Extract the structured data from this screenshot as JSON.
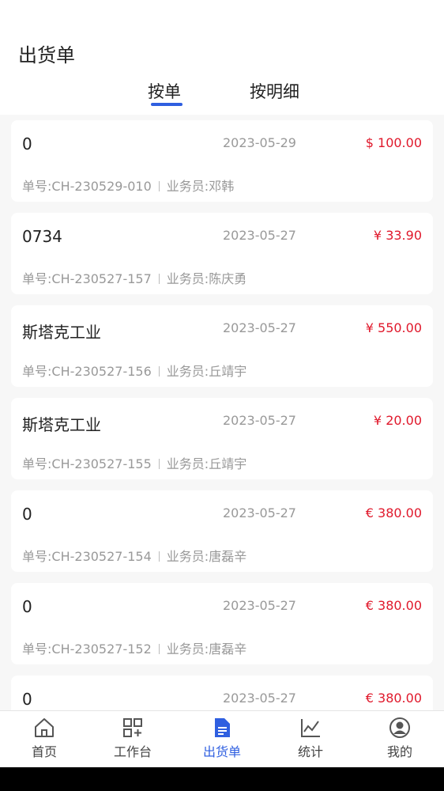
{
  "header": {
    "title": "出货单"
  },
  "tabs": [
    {
      "label": "按单",
      "active": true
    },
    {
      "label": "按明细",
      "active": false
    }
  ],
  "labels": {
    "order_no": "单号:",
    "salesperson": "业务员:"
  },
  "orders": [
    {
      "customer": "0",
      "date": "2023-05-29",
      "amount": "$ 100.00",
      "order_no": "CH-230529-010",
      "salesperson": "邓韩"
    },
    {
      "customer": "0734",
      "date": "2023-05-27",
      "amount": "¥ 33.90",
      "order_no": "CH-230527-157",
      "salesperson": "陈庆勇"
    },
    {
      "customer": "斯塔克工业",
      "date": "2023-05-27",
      "amount": "¥ 550.00",
      "order_no": "CH-230527-156",
      "salesperson": "丘靖宇"
    },
    {
      "customer": "斯塔克工业",
      "date": "2023-05-27",
      "amount": "¥ 20.00",
      "order_no": "CH-230527-155",
      "salesperson": "丘靖宇"
    },
    {
      "customer": "0",
      "date": "2023-05-27",
      "amount": "€ 380.00",
      "order_no": "CH-230527-154",
      "salesperson": "唐磊辛"
    },
    {
      "customer": "0",
      "date": "2023-05-27",
      "amount": "€ 380.00",
      "order_no": "CH-230527-152",
      "salesperson": "唐磊辛"
    },
    {
      "customer": "0",
      "date": "2023-05-27",
      "amount": "€ 380.00",
      "order_no": "",
      "salesperson": ""
    }
  ],
  "tabbar": {
    "items": [
      {
        "label": "首页",
        "icon": "home-icon"
      },
      {
        "label": "工作台",
        "icon": "workbench-icon"
      },
      {
        "label": "出货单",
        "icon": "document-icon",
        "active": true
      },
      {
        "label": "统计",
        "icon": "chart-icon"
      },
      {
        "label": "我的",
        "icon": "user-icon"
      }
    ]
  },
  "colors": {
    "accent": "#2f5fe0",
    "amount": "#e0182b",
    "muted": "#999999"
  }
}
